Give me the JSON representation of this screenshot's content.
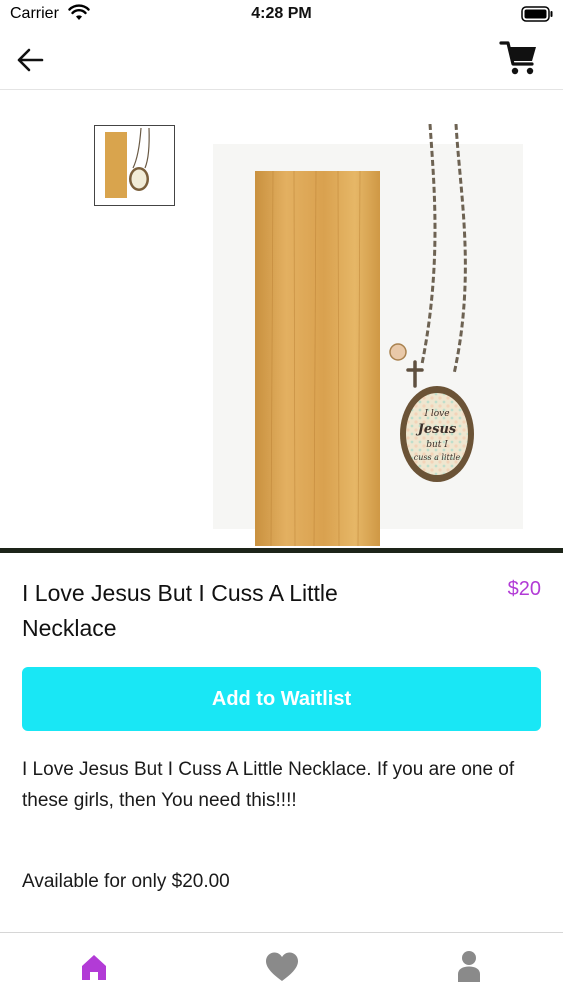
{
  "status_bar": {
    "carrier": "Carrier",
    "time": "4:28 PM"
  },
  "nav": {
    "back_icon": "arrow-left-icon",
    "cart_icon": "shopping-cart-icon"
  },
  "product": {
    "title": "I Love Jesus But I Cuss A Little Necklace",
    "price": "$20",
    "pendant_text": [
      "I love",
      "Jesus",
      "but I",
      "cuss a little"
    ],
    "waitlist_label": "Add to Waitlist",
    "description": "I Love Jesus But I Cuss A Little Necklace. If you are one of these girls, then You need this!!!!",
    "availability": "Available for only $20.00"
  },
  "tabs": [
    {
      "name": "home",
      "icon": "home-icon",
      "active": true
    },
    {
      "name": "favorites",
      "icon": "heart-icon",
      "active": false
    },
    {
      "name": "profile",
      "icon": "person-icon",
      "active": false
    }
  ],
  "colors": {
    "accent": "#b23bd6",
    "button": "#19e7f5",
    "inactive_icon": "#8a8a8a"
  }
}
